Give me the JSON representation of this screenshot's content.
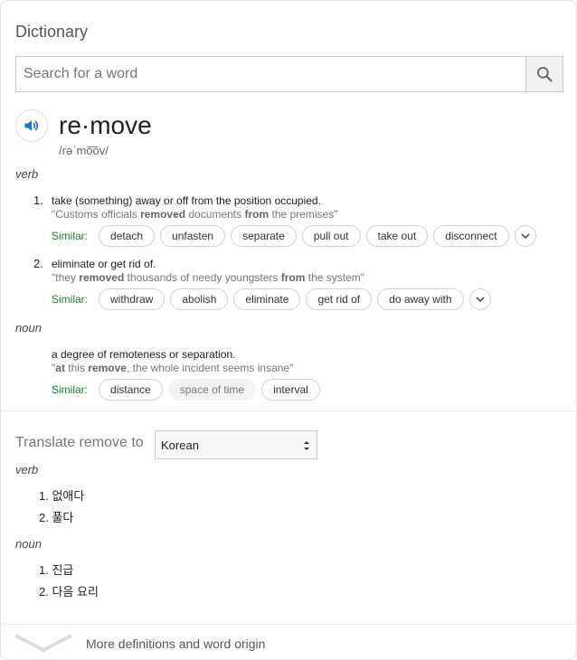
{
  "header": {
    "title": "Dictionary"
  },
  "search": {
    "placeholder": "Search for a word",
    "value": ""
  },
  "entry": {
    "word": "re·move",
    "phonetic": "/rəˈmo͞ov/",
    "verb_label": "verb",
    "verb_senses": [
      {
        "number": "1.",
        "definition": "take (something) away or off from the position occupied.",
        "example_parts": [
          "\"Customs officials ",
          "removed",
          " documents ",
          "from",
          " the premises\""
        ],
        "similar_label": "Similar:",
        "similar": [
          "detach",
          "unfasten",
          "separate",
          "pull out",
          "take out",
          "disconnect"
        ]
      },
      {
        "number": "2.",
        "definition": "eliminate or get rid of.",
        "example_parts": [
          "\"they ",
          "removed",
          " thousands of needy youngsters ",
          "from",
          " the system\""
        ],
        "similar_label": "Similar:",
        "similar": [
          "withdraw",
          "abolish",
          "eliminate",
          "get rid of",
          "do away with"
        ]
      }
    ],
    "noun_label": "noun",
    "noun_sense": {
      "definition": "a degree of remoteness or separation.",
      "example_parts": [
        "\"",
        "at",
        " this ",
        "remove",
        ", the whole incident seems insane\""
      ],
      "similar_label": "Similar:",
      "similar": [
        "distance",
        "space of time",
        "interval"
      ]
    }
  },
  "translate": {
    "label": "Translate remove to",
    "language": "Korean",
    "verb_label": "verb",
    "verb_items": [
      {
        "number": "1.",
        "text": "없애다"
      },
      {
        "number": "2.",
        "text": "풀다"
      }
    ],
    "noun_label": "noun",
    "noun_items": [
      {
        "number": "1.",
        "text": "진급"
      },
      {
        "number": "2.",
        "text": "다음 요리"
      }
    ]
  },
  "footer": {
    "more_label": "More definitions and word origin"
  },
  "icons": {
    "speaker": "speaker-icon",
    "search": "search-icon",
    "expand": "chevron-down-icon"
  },
  "colors": {
    "accent": "#1a73e8",
    "similar_label": "#188038"
  }
}
